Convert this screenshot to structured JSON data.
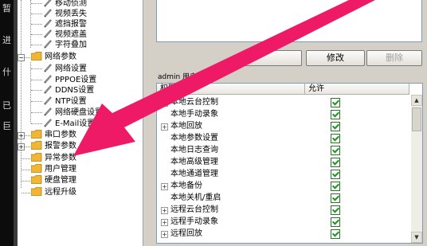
{
  "left_strip": {
    "glyphs": [
      "暂",
      "进",
      "什",
      "已",
      "巨"
    ]
  },
  "tree": {
    "items": [
      {
        "label": "移动侦测",
        "icon": "pen-icon"
      },
      {
        "label": "视频丢失",
        "icon": "pen-icon"
      },
      {
        "label": "遮挡报警",
        "icon": "pen-icon"
      },
      {
        "label": "视频遮盖",
        "icon": "pen-icon"
      },
      {
        "label": "字符叠加",
        "icon": "pen-icon"
      },
      {
        "label": "网络参数",
        "icon": "folder-icon",
        "expanded": true
      },
      {
        "label": "网络设置",
        "icon": "pen-icon"
      },
      {
        "label": "PPPOE设置",
        "icon": "pen-icon"
      },
      {
        "label": "DDNS设置",
        "icon": "pen-icon"
      },
      {
        "label": "NTP设置",
        "icon": "pen-icon"
      },
      {
        "label": "网络硬盘设置",
        "icon": "pen-icon"
      },
      {
        "label": "E-Mail设置",
        "icon": "pen-icon"
      },
      {
        "label": "串口参数",
        "icon": "folder-icon",
        "expandable": true
      },
      {
        "label": "报警参数",
        "icon": "folder-icon",
        "expandable": true
      },
      {
        "label": "异常参数",
        "icon": "folder-icon"
      },
      {
        "label": "用户管理",
        "icon": "folder-icon"
      },
      {
        "label": "硬盘管理",
        "icon": "folder-icon"
      },
      {
        "label": "远程升级",
        "icon": "folder-icon"
      }
    ]
  },
  "buttons": {
    "add": "",
    "modify": "修改",
    "delete": "删除"
  },
  "permissions": {
    "caption": "admin 用户的权限",
    "col_permission": "权限(P)",
    "col_allow": "允许",
    "rows": [
      {
        "label": "本地云台控制",
        "expandable": true,
        "checked": true
      },
      {
        "label": "本地手动录象",
        "expandable": false,
        "checked": true
      },
      {
        "label": "本地回放",
        "expandable": true,
        "checked": true
      },
      {
        "label": "本地参数设置",
        "expandable": false,
        "checked": true
      },
      {
        "label": "本地日志查询",
        "expandable": false,
        "checked": true
      },
      {
        "label": "本地高级管理",
        "expandable": false,
        "checked": true
      },
      {
        "label": "本地通道管理",
        "expandable": false,
        "checked": true
      },
      {
        "label": "本地备份",
        "expandable": true,
        "checked": true
      },
      {
        "label": "本地关机/重启",
        "expandable": false,
        "checked": true
      },
      {
        "label": "远程云台控制",
        "expandable": true,
        "checked": true
      },
      {
        "label": "远程手动录象",
        "expandable": true,
        "checked": true
      },
      {
        "label": "远程回放",
        "expandable": true,
        "checked": true
      }
    ]
  },
  "colors": {
    "arrow": "#ee1a66",
    "folder": "#f2b632",
    "check": "#1a9a1a"
  }
}
